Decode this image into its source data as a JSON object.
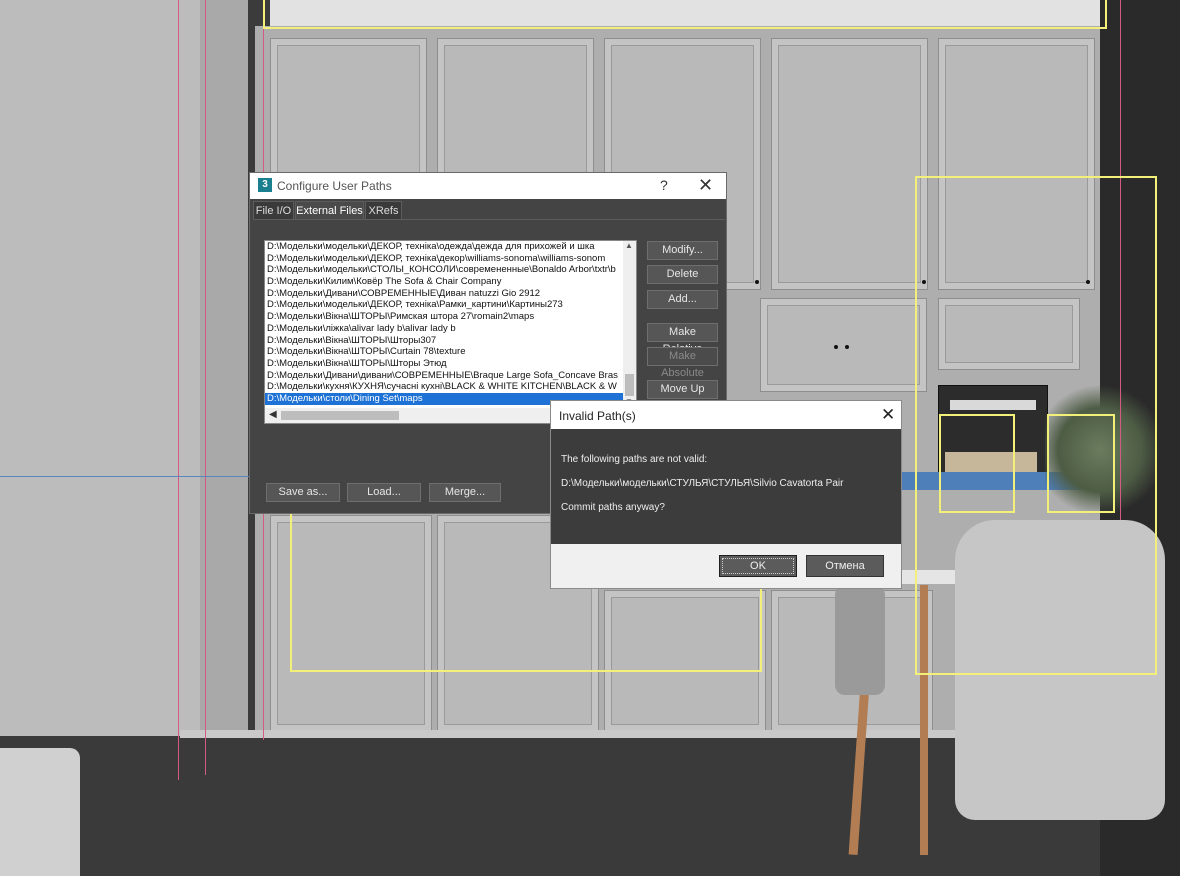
{
  "config_dialog": {
    "title": "Configure User Paths",
    "help_glyph": "?",
    "close_glyph": "✕",
    "app_icon_text": "3",
    "tabs": [
      {
        "label": "File I/O",
        "active": false
      },
      {
        "label": "External Files",
        "active": true
      },
      {
        "label": "XRefs",
        "active": false
      }
    ],
    "paths": [
      "D:\\Модельки\\модельки\\ДЕКОР, техніка\\одежда\\дежда для прихожей и шка",
      "D:\\Модельки\\модельки\\ДЕКОР, техніка\\декор\\williams-sonoma\\williams-sonom",
      "D:\\Модельки\\модельки\\СТОЛЫ_КОНСОЛИ\\современенные\\Bonaldo Arbor\\txtr\\b",
      "D:\\Модельки\\Килим\\Ковёр The Sofa & Chair Company",
      "D:\\Модельки\\Дивани\\СОВРЕМЕННЫЕ\\Диван natuzzi Gio 2912",
      "D:\\Модельки\\модельки\\ДЕКОР, техніка\\Рамки_картини\\Картины273",
      "D:\\Модельки\\Вікна\\ШТОРЫ\\Римская штора 27\\romain2\\maps",
      "D:\\Модельки\\ліжка\\alivar lady b\\alivar lady b",
      "D:\\Модельки\\Вікна\\ШТОРЫ\\Шторы307",
      "D:\\Модельки\\Вікна\\ШТОРЫ\\Curtain 78\\texture",
      "D:\\Модельки\\Вікна\\ШТОРЫ\\Шторы Этюд",
      "D:\\Модельки\\Дивани\\дивани\\СОВРЕМЕННЫЕ\\Braque Large Sofa_Concave Bras",
      "D:\\Модельки\\кухня\\КУХНЯ\\сучасні кухні\\BLACK & WHITE KITCHEN\\BLACK & W",
      "D:\\Модельки\\столи\\Dining Set\\maps"
    ],
    "selected_index": 13,
    "buttons": {
      "modify": "Modify...",
      "delete": "Delete",
      "add": "Add...",
      "make_relative": "Make Relative",
      "make_absolute": "Make Absolute",
      "move_up": "Move Up",
      "save_as": "Save as...",
      "load": "Load...",
      "merge": "Merge..."
    }
  },
  "invalid_dialog": {
    "title": "Invalid Path(s)",
    "close_glyph": "✕",
    "line1": "The following paths are not valid:",
    "path": "D:\\Модельки\\модельки\\СТУЛЬЯ\\СТУЛЬЯ\\Silvio Cavatorta Pair",
    "line3": "Commit paths anyway?",
    "ok_label": "OK",
    "cancel_label": "Отмена"
  },
  "colors": {
    "selection": "#1e72d6",
    "highlight_outline": "#f3f07a",
    "guide_lines": "#d35a83"
  }
}
